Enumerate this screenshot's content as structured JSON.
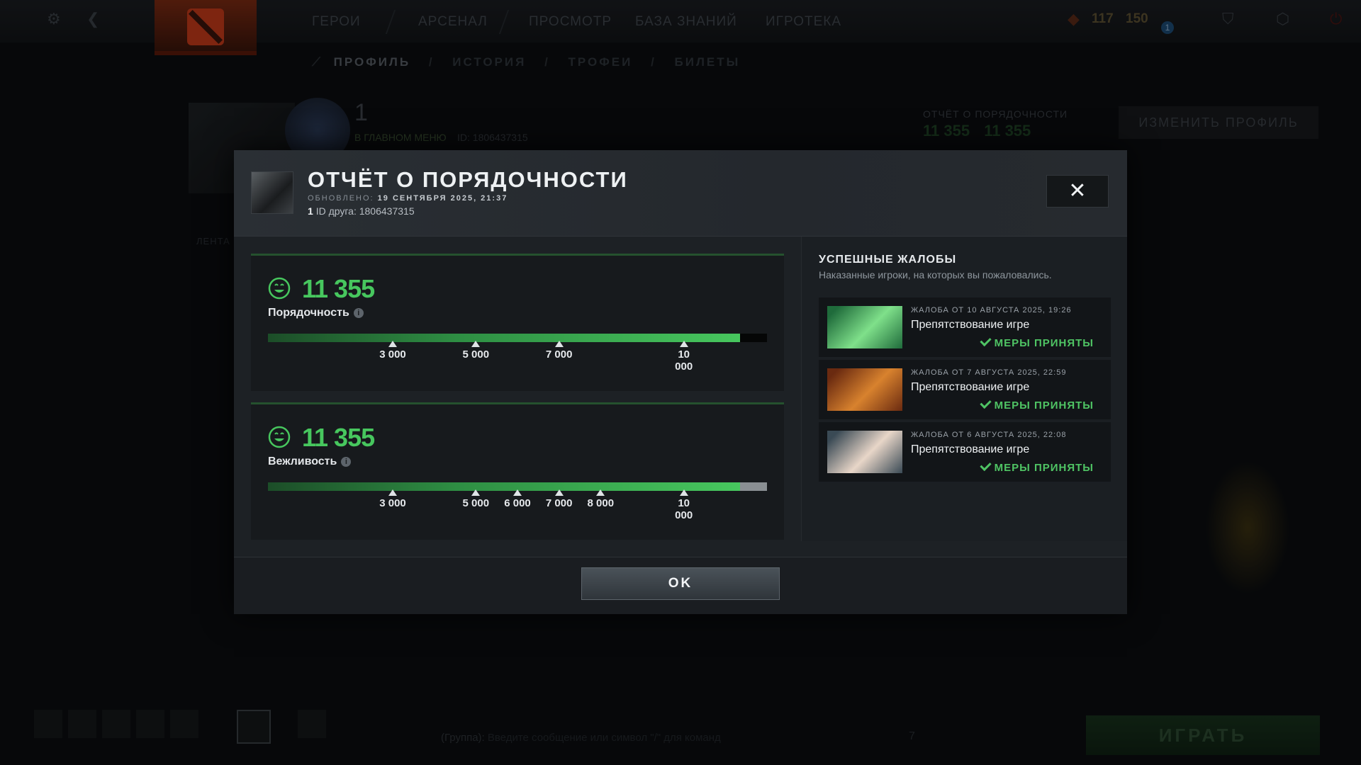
{
  "topbar": {
    "nav": [
      "ГЕРОИ",
      "АРСЕНАЛ",
      "ПРОСМОТР",
      "БАЗА ЗНАНИЙ",
      "ИГРОТЕКА"
    ],
    "currency_a": "117",
    "currency_b": "150",
    "notification_count": "1"
  },
  "subnav": [
    "ПРОФИЛЬ",
    "ИСТОРИЯ",
    "ТРОФЕИ",
    "БИЛЕТЫ"
  ],
  "profile": {
    "name": "1",
    "menu_link": "В ГЛАВНОМ МЕНЮ",
    "id_text": "ID: 1806437315",
    "conduct_label": "ОТЧЁТ О ПОРЯДОЧНОСТИ",
    "conduct_value_a": "11 355",
    "conduct_value_b": "11 355",
    "edit_button": "ИЗМЕНИТЬ ПРОФИЛЬ",
    "feed_label": "ЛЕНТА"
  },
  "modal": {
    "title": "ОТЧЁТ О ПОРЯДОЧНОСТИ",
    "updated_label": "ОБНОВЛЕНО:",
    "updated_value": "19 СЕНТЯБРЯ 2025, 21:37",
    "player_name": "1",
    "friend_id": "ID друга: 1806437315",
    "close_symbol": "✕",
    "ok_label": "OK"
  },
  "scores": [
    {
      "value": "11 355",
      "label": "Порядочность",
      "fill_fraction": 0.946,
      "track_style": "dark",
      "ticks": [
        {
          "value": 3000,
          "label": "3 000"
        },
        {
          "value": 5000,
          "label": "5 000"
        },
        {
          "value": 7000,
          "label": "7 000"
        },
        {
          "value": 10000,
          "label": "10 000"
        }
      ]
    },
    {
      "value": "11 355",
      "label": "Вежливость",
      "fill_fraction": 0.946,
      "track_style": "grey",
      "ticks": [
        {
          "value": 3000,
          "label": "3 000"
        },
        {
          "value": 5000,
          "label": "5 000"
        },
        {
          "value": 6000,
          "label": "6 000"
        },
        {
          "value": 7000,
          "label": "7 000"
        },
        {
          "value": 8000,
          "label": "8 000"
        },
        {
          "value": 10000,
          "label": "10 000"
        }
      ]
    }
  ],
  "reports": {
    "title": "УСПЕШНЫЕ ЖАЛОБЫ",
    "subtitle": "Наказанные игроки, на которых вы пожаловались.",
    "items": [
      {
        "date": "ЖАЛОБА ОТ 10 АВГУСТА 2025, 19:26",
        "reason": "Препятствование игре",
        "status": "МЕРЫ ПРИНЯТЫ",
        "hero_icon": "necrophos-portrait",
        "colors": [
          "#1f6b3b",
          "#7fe08a"
        ]
      },
      {
        "date": "ЖАЛОБА ОТ 7 АВГУСТА 2025, 22:59",
        "reason": "Препятствование игре",
        "status": "МЕРЫ ПРИНЯТЫ",
        "hero_icon": "bristleback-portrait",
        "colors": [
          "#6a2a10",
          "#d8822e"
        ]
      },
      {
        "date": "ЖАЛОБА ОТ 6 АВГУСТА 2025, 22:08",
        "reason": "Препятствование игре",
        "status": "МЕРЫ ПРИНЯТЫ",
        "hero_icon": "sniper-portrait",
        "colors": [
          "#3a4a55",
          "#e8d6c8"
        ]
      }
    ]
  },
  "bottom": {
    "chat_prefix": "(Группа):",
    "chat_placeholder": "Введите сообщение или символ \"/\" для команд",
    "chat_count": "7",
    "play_button": "ИГРАТЬ"
  },
  "colors": {
    "accent_green": "#47c75e",
    "status_green": "#4fc464",
    "modal_bg": "#1d2125"
  }
}
